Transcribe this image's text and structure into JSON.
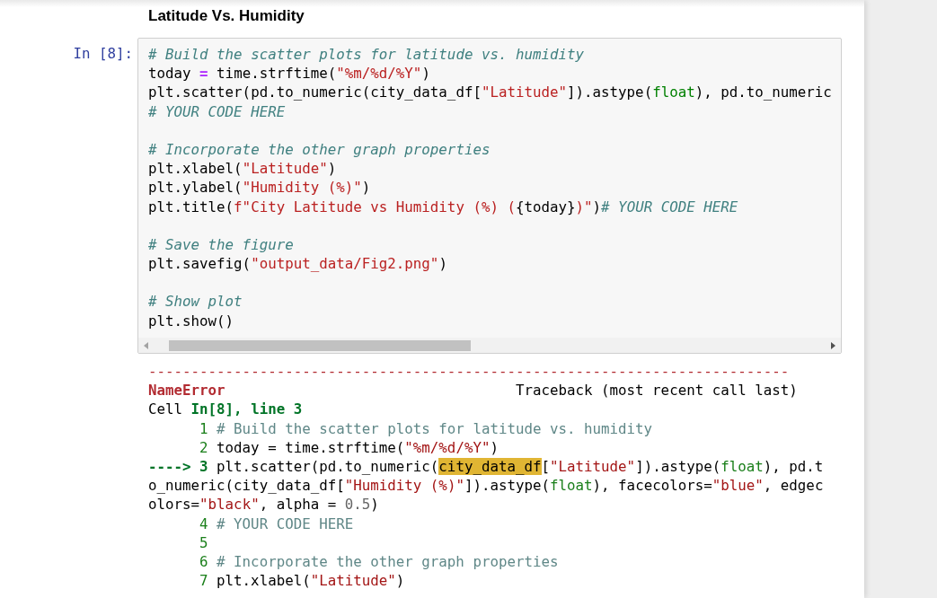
{
  "heading": "Latitude Vs. Humidity",
  "cell": {
    "prompt": "In [8]:",
    "lines": [
      {
        "kind": "code",
        "tokens": [
          {
            "kind": "comment",
            "text": "# Build the scatter plots for latitude vs. humidity"
          }
        ]
      },
      {
        "kind": "code",
        "tokens": [
          {
            "kind": "plain",
            "text": "today "
          },
          {
            "kind": "op",
            "text": "="
          },
          {
            "kind": "plain",
            "text": " time.strftime("
          },
          {
            "kind": "string",
            "text": "\"%m/%d/%Y\""
          },
          {
            "kind": "plain",
            "text": ")"
          }
        ]
      },
      {
        "kind": "code",
        "tokens": [
          {
            "kind": "plain",
            "text": "plt.scatter(pd.to_numeric(city_data_df["
          },
          {
            "kind": "string",
            "text": "\"Latitude\""
          },
          {
            "kind": "plain",
            "text": "]).astype("
          },
          {
            "kind": "builtin",
            "text": "float"
          },
          {
            "kind": "plain",
            "text": "), pd.to_numeric"
          }
        ]
      },
      {
        "kind": "code",
        "tokens": [
          {
            "kind": "comment",
            "text": "# YOUR CODE HERE"
          }
        ]
      },
      {
        "kind": "blank"
      },
      {
        "kind": "code",
        "tokens": [
          {
            "kind": "comment",
            "text": "# Incorporate the other graph properties"
          }
        ]
      },
      {
        "kind": "code",
        "tokens": [
          {
            "kind": "plain",
            "text": "plt.xlabel("
          },
          {
            "kind": "string",
            "text": "\"Latitude\""
          },
          {
            "kind": "plain",
            "text": ")"
          }
        ]
      },
      {
        "kind": "code",
        "tokens": [
          {
            "kind": "plain",
            "text": "plt.ylabel("
          },
          {
            "kind": "string",
            "text": "\"Humidity (%)\""
          },
          {
            "kind": "plain",
            "text": ")"
          }
        ]
      },
      {
        "kind": "code",
        "tokens": [
          {
            "kind": "plain",
            "text": "plt.title("
          },
          {
            "kind": "string",
            "text": "f\"City Latitude vs Humidity (%) ("
          },
          {
            "kind": "plain",
            "text": "{today}"
          },
          {
            "kind": "string",
            "text": ")\""
          },
          {
            "kind": "plain",
            "text": ")"
          },
          {
            "kind": "comment",
            "text": "# YOUR CODE HERE"
          }
        ]
      },
      {
        "kind": "blank"
      },
      {
        "kind": "code",
        "tokens": [
          {
            "kind": "comment",
            "text": "# Save the figure"
          }
        ]
      },
      {
        "kind": "code",
        "tokens": [
          {
            "kind": "plain",
            "text": "plt.savefig("
          },
          {
            "kind": "string",
            "text": "\"output_data/Fig2.png\""
          },
          {
            "kind": "plain",
            "text": ")"
          }
        ]
      },
      {
        "kind": "blank"
      },
      {
        "kind": "code",
        "tokens": [
          {
            "kind": "comment",
            "text": "# Show plot"
          }
        ]
      },
      {
        "kind": "code",
        "tokens": [
          {
            "kind": "plain",
            "text": "plt.show()"
          }
        ]
      }
    ]
  },
  "output": {
    "lines": [
      {
        "kind": "rule",
        "text": "---------------------------------------------------------------------------"
      },
      {
        "kind": "header",
        "error_name": "NameError",
        "traceback": "Traceback (most recent call last)"
      },
      {
        "kind": "code",
        "tokens": [
          {
            "kind": "plain",
            "text": "Cell "
          },
          {
            "kind": "emph",
            "text": "In[8], line 3"
          }
        ]
      },
      {
        "kind": "numbered",
        "number": "1",
        "tokens": [
          {
            "kind": "comment",
            "text": "# Build the scatter plots for latitude vs. humidity"
          }
        ]
      },
      {
        "kind": "numbered",
        "number": "2",
        "tokens": [
          {
            "kind": "plain",
            "text": "today = time.strftime("
          },
          {
            "kind": "string",
            "text": "\"%m/%d/%Y\""
          },
          {
            "kind": "plain",
            "text": ")"
          }
        ]
      },
      {
        "kind": "current",
        "arrow": "---->",
        "number": "3",
        "tokens": [
          {
            "kind": "plain",
            "text": "plt.scatter(pd.to_numeric("
          },
          {
            "kind": "highlight",
            "text": "city_data_df"
          },
          {
            "kind": "plain",
            "text": "["
          },
          {
            "kind": "string",
            "text": "\"Latitude\""
          },
          {
            "kind": "plain",
            "text": "]).astype("
          },
          {
            "kind": "builtin",
            "text": "float"
          },
          {
            "kind": "plain",
            "text": "), pd.t"
          }
        ]
      },
      {
        "kind": "code",
        "tokens": [
          {
            "kind": "plain",
            "text": "o_numeric(city_data_df["
          },
          {
            "kind": "string",
            "text": "\"Humidity (%)\""
          },
          {
            "kind": "plain",
            "text": "]).astype("
          },
          {
            "kind": "builtin",
            "text": "float"
          },
          {
            "kind": "plain",
            "text": "), facecolors="
          },
          {
            "kind": "string",
            "text": "\"blue\""
          },
          {
            "kind": "plain",
            "text": ", edgec"
          }
        ]
      },
      {
        "kind": "code",
        "tokens": [
          {
            "kind": "plain",
            "text": "olors="
          },
          {
            "kind": "string",
            "text": "\"black\""
          },
          {
            "kind": "plain",
            "text": ", alpha = "
          },
          {
            "kind": "number",
            "text": "0.5"
          },
          {
            "kind": "plain",
            "text": ")"
          }
        ]
      },
      {
        "kind": "numbered",
        "number": "4",
        "tokens": [
          {
            "kind": "comment",
            "text": "# YOUR CODE HERE"
          }
        ]
      },
      {
        "kind": "numbered",
        "number": "5"
      },
      {
        "kind": "numbered",
        "number": "6",
        "tokens": [
          {
            "kind": "comment",
            "text": "# Incorporate the other graph properties"
          }
        ]
      },
      {
        "kind": "numbered",
        "number": "7",
        "tokens": [
          {
            "kind": "plain",
            "text": "plt.xlabel("
          },
          {
            "kind": "string",
            "text": "\"Latitude\""
          },
          {
            "kind": "plain",
            "text": ")"
          }
        ]
      }
    ]
  }
}
